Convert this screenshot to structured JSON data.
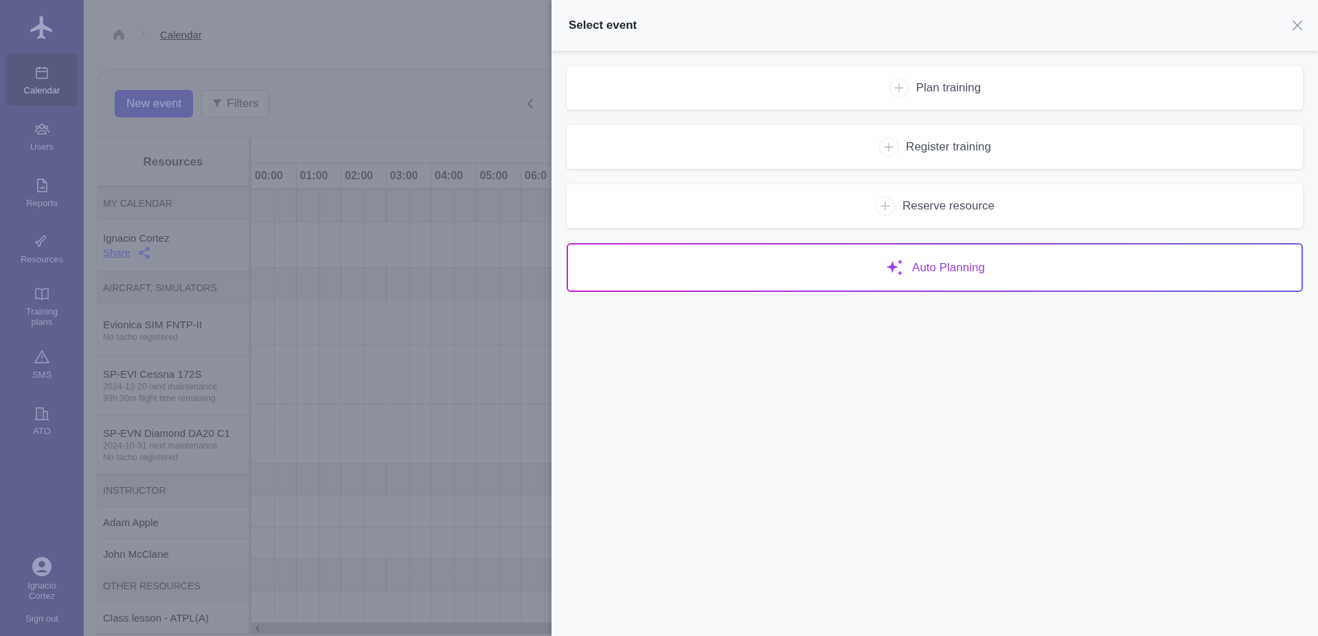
{
  "sidebar": {
    "items": [
      {
        "label": "Calendar",
        "selected": true
      },
      {
        "label": "Users",
        "selected": false
      },
      {
        "label": "Reports",
        "selected": false
      },
      {
        "label": "Resources",
        "selected": false
      },
      {
        "label": "Training plans",
        "selected": false
      },
      {
        "label": "SMS",
        "selected": false
      },
      {
        "label": "ATO",
        "selected": false
      }
    ],
    "user": {
      "name": "Ignacio Cortez"
    },
    "sign_out": "Sign out"
  },
  "breadcrumb": [
    "Calendar"
  ],
  "toolbar": {
    "new_event": "New event",
    "filters": "Filters"
  },
  "table": {
    "resources_heading": "Resources",
    "hours": [
      "00:00",
      "01:00",
      "02:00",
      "03:00",
      "04:00",
      "05:00",
      "06:0"
    ],
    "groups": [
      {
        "title": "MY CALENDAR",
        "rows": [
          {
            "name": "Ignacio Cortez",
            "details": [],
            "link": "Share"
          }
        ]
      },
      {
        "title": "AIRCRAFT, SIMULATORS",
        "rows": [
          {
            "name": "Evionica SIM FNTP-II",
            "details": [
              "No tacho registered"
            ]
          },
          {
            "name": "SP-EVI Cessna 172S",
            "details": [
              "2024-12-20 next maintenance",
              "99h 30m flight time remaining"
            ]
          },
          {
            "name": "SP-EVN Diamond DA20 C1",
            "details": [
              "2024-10-31 next maintenance",
              "No tacho registered"
            ]
          }
        ]
      },
      {
        "title": "INSTRUCTOR",
        "rows": [
          {
            "name": "Adam Apple",
            "details": []
          },
          {
            "name": "John McClane",
            "details": []
          }
        ]
      },
      {
        "title": "OTHER RESOURCES",
        "rows": [
          {
            "name": "Class lesson - ATPL(A)",
            "details": []
          }
        ]
      }
    ]
  },
  "drawer": {
    "title": "Select event",
    "options": [
      {
        "label": "Plan training",
        "kind": "plus"
      },
      {
        "label": "Register training",
        "kind": "plus"
      },
      {
        "label": "Reserve resource",
        "kind": "plus"
      },
      {
        "label": "Auto Planning",
        "kind": "auto"
      }
    ]
  }
}
